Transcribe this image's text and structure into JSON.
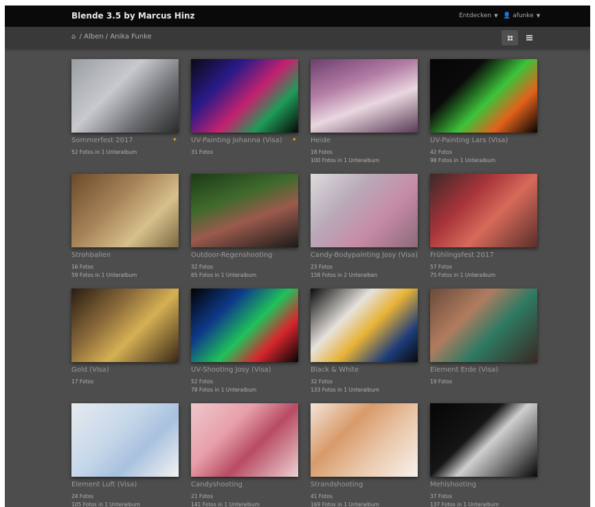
{
  "header": {
    "brand": "Blende 3.5 by Marcus Hinz",
    "menu_entdecken": "Entdecken",
    "user": "afunke"
  },
  "breadcrumb": {
    "items": [
      "Alben",
      "Anika Funke"
    ],
    "separator": "/"
  },
  "albums": [
    {
      "title": "Sommerfest 2017",
      "lines": [
        "52 Fotos in 1 Unteralbum"
      ],
      "flag": true
    },
    {
      "title": "UV-Painting Johanna (Visa)",
      "lines": [
        "31 Fotos"
      ],
      "flag": true
    },
    {
      "title": "Heide",
      "lines": [
        "18 Fotos",
        "100 Fotos in 1 Unteralbum"
      ],
      "flag": false
    },
    {
      "title": "UV-Painting Lars (Visa)",
      "lines": [
        "42 Fotos",
        "98 Fotos in 1 Unteralbum"
      ],
      "flag": false
    },
    {
      "title": "Strohballen",
      "lines": [
        "16 Fotos",
        "59 Fotos in 1 Unteralbum"
      ],
      "flag": false
    },
    {
      "title": "Outdoor-Regenshooting",
      "lines": [
        "32 Fotos",
        "65 Fotos in 1 Unteralbum"
      ],
      "flag": false
    },
    {
      "title": "Candy-Bodypainting Josy (Visa)",
      "lines": [
        "23 Fotos",
        "158 Fotos in 2 Unteralben"
      ],
      "flag": false
    },
    {
      "title": "Frühlingsfest 2017",
      "lines": [
        "57 Fotos",
        "75 Fotos in 1 Unteralbum"
      ],
      "flag": false
    },
    {
      "title": "Gold (Visa)",
      "lines": [
        "17 Fotos"
      ],
      "flag": false
    },
    {
      "title": "UV-Shooting Josy (Visa)",
      "lines": [
        "52 Fotos",
        "78 Fotos in 1 Unteralbum"
      ],
      "flag": false
    },
    {
      "title": "Black & White",
      "lines": [
        "32 Fotos",
        "133 Fotos in 1 Unteralbum"
      ],
      "flag": false
    },
    {
      "title": "Element Erde (Visa)",
      "lines": [
        "19 Fotos"
      ],
      "flag": false
    },
    {
      "title": "Element Luft (Visa)",
      "lines": [
        "24 Fotos",
        "105 Fotos in 1 Unteralbum"
      ],
      "flag": false
    },
    {
      "title": "Candyshooting",
      "lines": [
        "21 Fotos",
        "141 Fotos in 1 Unteralbum"
      ],
      "flag": false
    },
    {
      "title": "Strandshooting",
      "lines": [
        "41 Fotos",
        "169 Fotos in 1 Unteralbum"
      ],
      "flag": false
    },
    {
      "title": "Mehlshooting",
      "lines": [
        "37 Fotos",
        "137 Fotos in 1 Unteralbum"
      ],
      "flag": false
    }
  ],
  "colors": {
    "flag": "#d4a81c"
  }
}
